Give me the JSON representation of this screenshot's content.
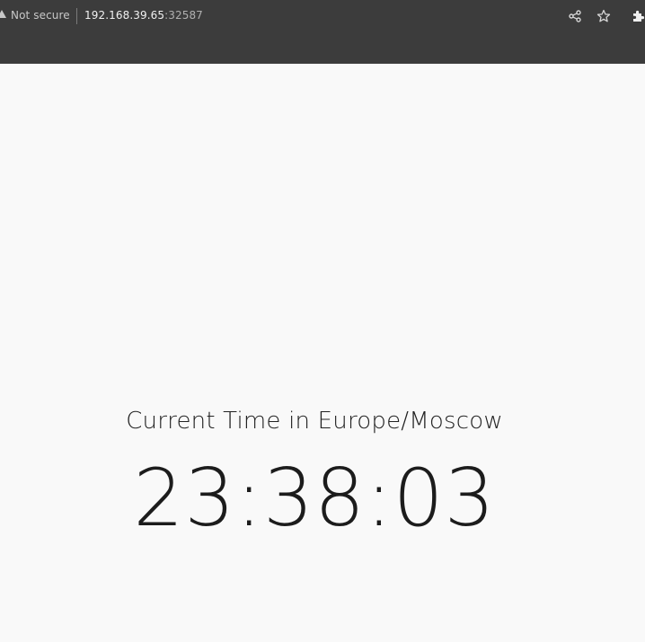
{
  "browser": {
    "security_label": "Not secure",
    "url_host": "192.168.39.65",
    "url_port": ":32587",
    "icons": [
      "warning-icon",
      "share-icon",
      "star-icon",
      "extensions-icon"
    ]
  },
  "page": {
    "heading": "Current Time in Europe/Moscow",
    "time": "23:38:03"
  },
  "colors": {
    "chrome_bg": "#3c3c3c",
    "page_bg": "#f9f9f9",
    "text": "#222222"
  }
}
